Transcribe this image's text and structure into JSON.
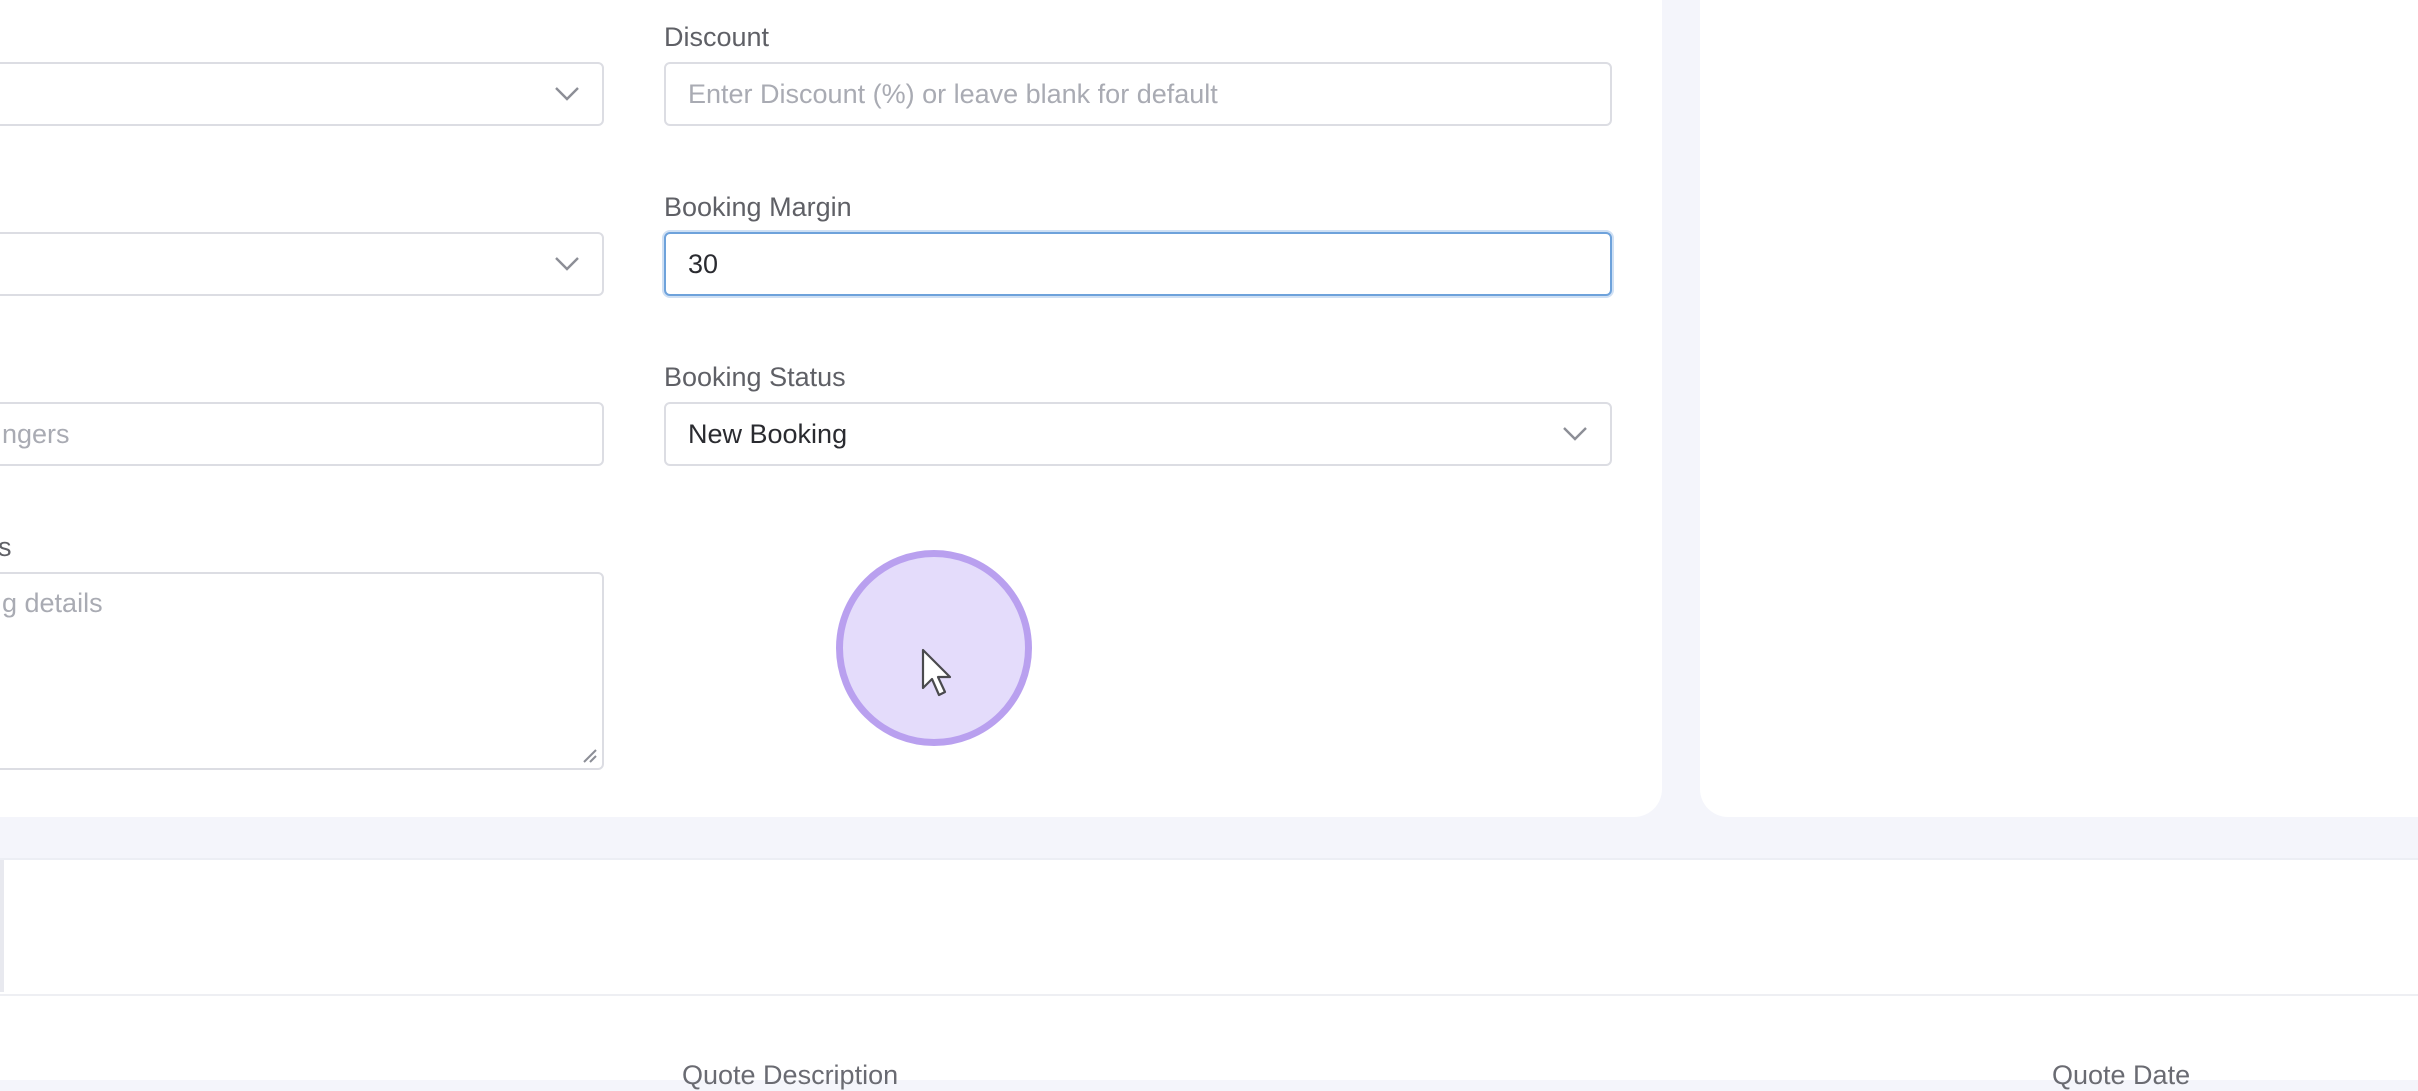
{
  "form": {
    "left_select_1": {
      "value": ""
    },
    "left_select_2": {
      "value": ""
    },
    "passengers": {
      "placeholder": "ngers"
    },
    "details": {
      "label": "s",
      "placeholder": "g details"
    },
    "discount": {
      "label": "Discount",
      "placeholder": "Enter Discount (%) or leave blank for default"
    },
    "booking_margin": {
      "label": "Booking Margin",
      "value": "30"
    },
    "booking_status": {
      "label": "Booking Status",
      "value": "New Booking"
    }
  },
  "table": {
    "headers": [
      "Quote Description",
      "Quote Date"
    ]
  },
  "colors": {
    "focus_border": "#6ea2db",
    "cursor_ring": "#b9a0ef",
    "cursor_fill": "#e4dcfb"
  },
  "icons": [
    "chevron-down-icon",
    "resize-handle-icon",
    "mouse-pointer-icon"
  ]
}
